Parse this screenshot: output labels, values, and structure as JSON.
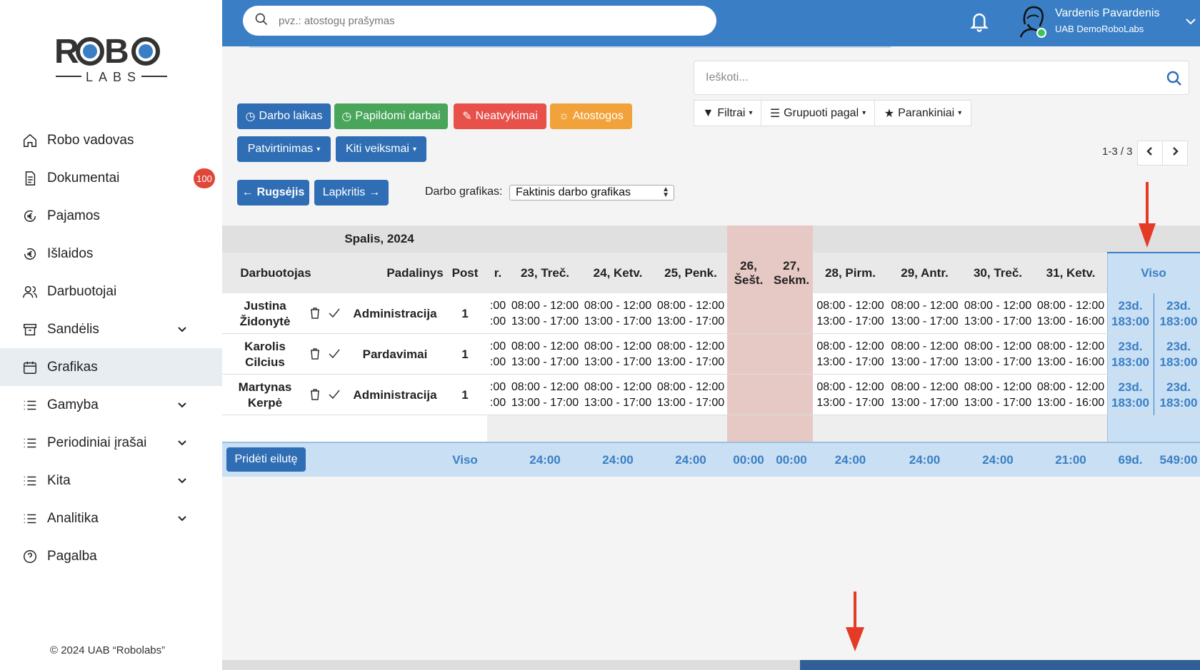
{
  "sidebar": {
    "logo_text": "ROBO LABS",
    "items": [
      {
        "label": "Robo vadovas",
        "icon": "home-icon"
      },
      {
        "label": "Dokumentai",
        "icon": "document-icon",
        "badge": "100"
      },
      {
        "label": "Pajamos",
        "icon": "euro-in-icon"
      },
      {
        "label": "Išlaidos",
        "icon": "euro-out-icon"
      },
      {
        "label": "Darbuotojai",
        "icon": "users-icon"
      },
      {
        "label": "Sandėlis",
        "icon": "archive-icon"
      },
      {
        "label": "Grafikas",
        "icon": "calendar-icon"
      },
      {
        "label": "Gamyba",
        "icon": "list-icon"
      },
      {
        "label": "Periodiniai įrašai",
        "icon": "list-icon"
      },
      {
        "label": "Kita",
        "icon": "list-icon"
      },
      {
        "label": "Analitika",
        "icon": "list-icon"
      },
      {
        "label": "Pagalba",
        "icon": "help-icon"
      }
    ],
    "copyright": "© 2024 UAB “Robolabs”"
  },
  "topbar": {
    "search_placeholder": "pvz.: atostogų prašymas",
    "user_name": "Vardenis Pavardenis",
    "user_company": "UAB DemoRoboLabs"
  },
  "toolbar": {
    "darbo_laikas": "Darbo laikas",
    "papildomi": "Papildomi darbai",
    "neatvykimai": "Neatvykimai",
    "atostogos": "Atostogos",
    "patvirtinimas": "Patvirtinimas",
    "kiti": "Kiti veiksmai",
    "prev_month": "Rugsėjis",
    "next_month": "Lapkritis",
    "sched_label": "Darbo grafikas:",
    "sched_value": "Faktinis darbo grafikas",
    "search_placeholder": "Ieškoti...",
    "filtrai": "Filtrai",
    "grupuoti": "Grupuoti pagal",
    "parankiniai": "Parankiniai",
    "pager": "1-3 / 3"
  },
  "grid": {
    "month": "Spalis, 2024",
    "col_employee": "Darbuotojas",
    "col_department": "Padalinys",
    "col_post": "Post",
    "col_partial": "r.",
    "days": [
      {
        "label": "23, Treč."
      },
      {
        "label": "24, Ketv."
      },
      {
        "label": "25, Penk."
      },
      {
        "label": "26, Šešt.",
        "weekend": true
      },
      {
        "label": "27, Sekm.",
        "weekend": true
      },
      {
        "label": "28, Pirm."
      },
      {
        "label": "29, Antr."
      },
      {
        "label": "30, Treč."
      },
      {
        "label": "31, Ketv."
      }
    ],
    "col_total": "Viso",
    "rows": [
      {
        "name": "Justina Židonytė",
        "department": "Administracija",
        "post": "1",
        "partial": [
          ":00",
          ":00"
        ],
        "shifts": [
          [
            "08:00 - 12:00",
            "13:00 - 17:00"
          ],
          [
            "08:00 - 12:00",
            "13:00 - 17:00"
          ],
          [
            "08:00 - 12:00",
            "13:00 - 17:00"
          ],
          [
            "",
            ""
          ],
          [
            "",
            ""
          ],
          [
            "08:00 - 12:00",
            "13:00 - 17:00"
          ],
          [
            "08:00 - 12:00",
            "13:00 - 17:00"
          ],
          [
            "08:00 - 12:00",
            "13:00 - 17:00"
          ],
          [
            "08:00 - 12:00",
            "13:00 - 16:00"
          ]
        ],
        "total_a": [
          "23d.",
          "183:00"
        ],
        "total_b": [
          "23d.",
          "183:00"
        ]
      },
      {
        "name": "Karolis Cilcius",
        "department": "Pardavimai",
        "post": "1",
        "partial": [
          ":00",
          ":00"
        ],
        "shifts": [
          [
            "08:00 - 12:00",
            "13:00 - 17:00"
          ],
          [
            "08:00 - 12:00",
            "13:00 - 17:00"
          ],
          [
            "08:00 - 12:00",
            "13:00 - 17:00"
          ],
          [
            "",
            ""
          ],
          [
            "",
            ""
          ],
          [
            "08:00 - 12:00",
            "13:00 - 17:00"
          ],
          [
            "08:00 - 12:00",
            "13:00 - 17:00"
          ],
          [
            "08:00 - 12:00",
            "13:00 - 17:00"
          ],
          [
            "08:00 - 12:00",
            "13:00 - 16:00"
          ]
        ],
        "total_a": [
          "23d.",
          "183:00"
        ],
        "total_b": [
          "23d.",
          "183:00"
        ]
      },
      {
        "name": "Martynas Kerpė",
        "department": "Administracija",
        "post": "1",
        "partial": [
          ":00",
          ":00"
        ],
        "shifts": [
          [
            "08:00 - 12:00",
            "13:00 - 17:00"
          ],
          [
            "08:00 - 12:00",
            "13:00 - 17:00"
          ],
          [
            "08:00 - 12:00",
            "13:00 - 17:00"
          ],
          [
            "",
            ""
          ],
          [
            "",
            ""
          ],
          [
            "08:00 - 12:00",
            "13:00 - 17:00"
          ],
          [
            "08:00 - 12:00",
            "13:00 - 17:00"
          ],
          [
            "08:00 - 12:00",
            "13:00 - 17:00"
          ],
          [
            "08:00 - 12:00",
            "13:00 - 16:00"
          ]
        ],
        "total_a": [
          "23d.",
          "183:00"
        ],
        "total_b": [
          "23d.",
          "183:00"
        ]
      }
    ],
    "footer": {
      "add_row": "Pridėti eilutę",
      "total_label": "Viso",
      "day_totals": [
        "24:00",
        "24:00",
        "24:00",
        "00:00",
        "00:00",
        "24:00",
        "24:00",
        "24:00",
        "21:00"
      ],
      "total_days": "69d.",
      "total_hours": "549:00"
    }
  },
  "colors": {
    "brand_blue": "#3a7fc5",
    "weekend": "#e6c9c4",
    "total_col": "#c9dff3",
    "annotation_red": "#e53a26"
  }
}
